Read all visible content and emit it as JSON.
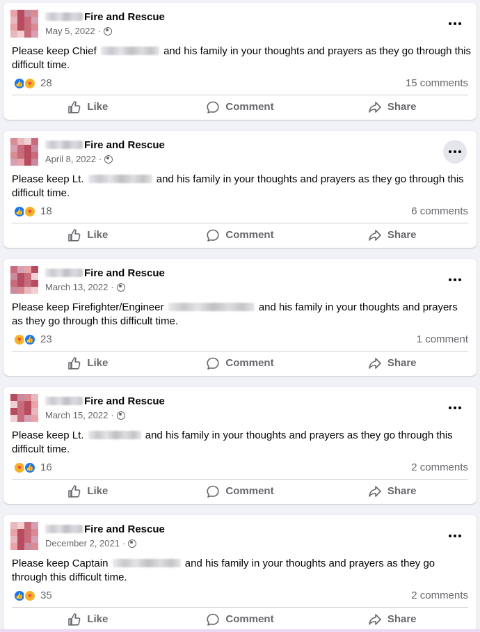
{
  "colors": {
    "background": "#f0f2f5",
    "card": "#ffffff",
    "secondary_text": "#65676b",
    "like_blue": "#1877f2",
    "care_yellow": "#f7b125"
  },
  "posts": [
    {
      "author_suffix": "Fire and Rescue",
      "date": "May 5, 2022",
      "separator": "·",
      "privacy_icon": "globe-icon",
      "text_before": "Please keep Chief",
      "text_after": "and his family in your thoughts and prayers as they go through this difficult time.",
      "reaction_order": [
        "like",
        "care"
      ],
      "reaction_count": "28",
      "comments": "15 comments",
      "more_hover": false
    },
    {
      "author_suffix": "Fire and Rescue",
      "date": "April 8, 2022",
      "separator": "·",
      "privacy_icon": "globe-icon",
      "text_before": "Please keep Lt.",
      "text_after": "and his family in your thoughts and prayers as they go through this difficult time.",
      "reaction_order": [
        "like",
        "care"
      ],
      "reaction_count": "18",
      "comments": "6 comments",
      "more_hover": true
    },
    {
      "author_suffix": "Fire and Rescue",
      "date": "March 13, 2022",
      "separator": "·",
      "privacy_icon": "globe-icon",
      "text_before": "Please keep Firefighter/Engineer",
      "text_after": "and his family in your thoughts and prayers as they go through this difficult time.",
      "reaction_order": [
        "care",
        "like"
      ],
      "reaction_count": "23",
      "comments": "1 comment",
      "more_hover": false
    },
    {
      "author_suffix": "Fire and Rescue",
      "date": "March 15, 2022",
      "separator": "·",
      "privacy_icon": "globe-icon",
      "text_before": "Please keep Lt.",
      "text_after": "and his family in your thoughts and prayers as they go through this difficult time.",
      "reaction_order": [
        "care",
        "like"
      ],
      "reaction_count": "16",
      "comments": "2 comments",
      "more_hover": false
    },
    {
      "author_suffix": "Fire and Rescue",
      "date": "December 2, 2021",
      "separator": "·",
      "privacy_icon": "globe-icon",
      "text_before": "Please keep Captain",
      "text_after": "and his family in your thoughts and prayers as they go through this difficult time.",
      "reaction_order": [
        "like",
        "care"
      ],
      "reaction_count": "35",
      "comments": "2 comments",
      "more_hover": false
    }
  ],
  "actions": {
    "like": "Like",
    "comment": "Comment",
    "share": "Share"
  }
}
